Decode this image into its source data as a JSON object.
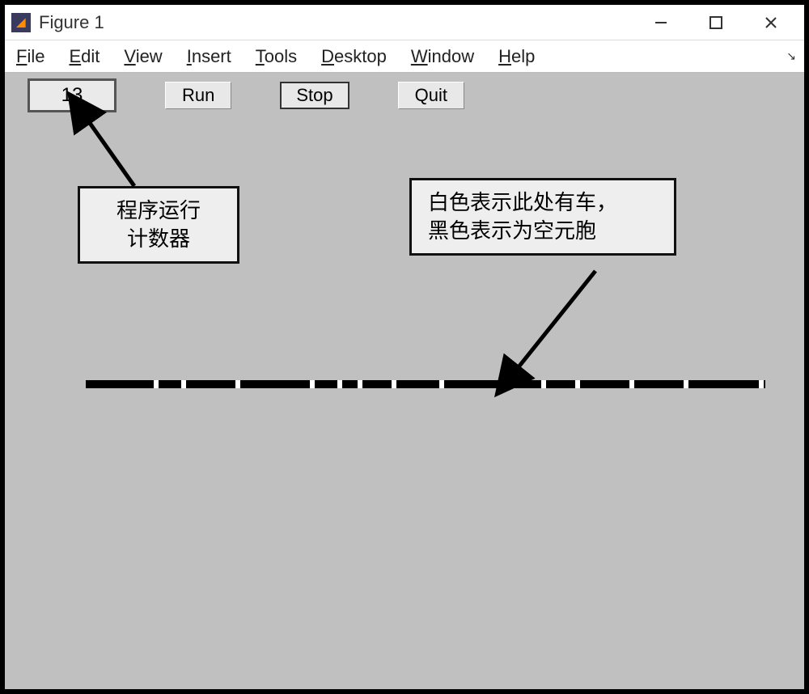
{
  "window": {
    "title": "Figure 1"
  },
  "menubar": {
    "items": [
      {
        "label": "File",
        "accel": "F"
      },
      {
        "label": "Edit",
        "accel": "E"
      },
      {
        "label": "View",
        "accel": "V"
      },
      {
        "label": "Insert",
        "accel": "I"
      },
      {
        "label": "Tools",
        "accel": "T"
      },
      {
        "label": "Desktop",
        "accel": "D"
      },
      {
        "label": "Window",
        "accel": "W"
      },
      {
        "label": "Help",
        "accel": "H"
      }
    ]
  },
  "toolbar": {
    "counter_value": "13",
    "run_label": "Run",
    "stop_label": "Stop",
    "quit_label": "Quit"
  },
  "annotations": {
    "counter_note_l1": "程序运行",
    "counter_note_l2": "计数器",
    "legend_note_l1": "白色表示此处有车，",
    "legend_note_l2": "黑色表示为空元胞"
  },
  "simulation": {
    "car_positions_pct": [
      10,
      14,
      22,
      33,
      37,
      40,
      45,
      52,
      67,
      72,
      80,
      88,
      99
    ]
  }
}
